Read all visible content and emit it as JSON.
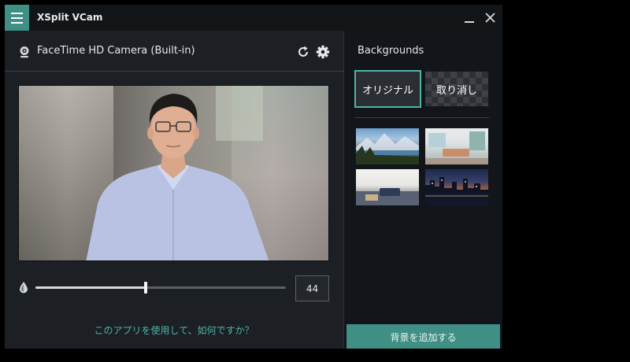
{
  "window": {
    "title": "XSplit VCam"
  },
  "camera": {
    "name": "FaceTime HD Camera (Built-in)"
  },
  "controls": {
    "blur_value": "44",
    "blur_fraction": 0.44
  },
  "feedback": {
    "link_text": "このアプリを使用して、如何ですか？"
  },
  "backgrounds": {
    "title": "Backgrounds",
    "original_label": "オリジナル",
    "remove_label": "取り消し",
    "add_button_label": "背景を追加する",
    "thumbnails": [
      "mountain-lake",
      "living-room",
      "bedroom",
      "city-night"
    ]
  },
  "colors": {
    "accent": "#3f8f84",
    "accent_text": "#4fb3a6",
    "panel_bg": "#1c2025",
    "sidebar_bg": "#121519",
    "titlebar_bg": "#121518"
  },
  "icons": {
    "menu": "hamburger-icon",
    "minimize": "minimize-icon",
    "close": "close-icon",
    "camera": "webcam-icon",
    "refresh": "refresh-icon",
    "settings": "gear-icon",
    "opacity": "droplet-icon"
  }
}
